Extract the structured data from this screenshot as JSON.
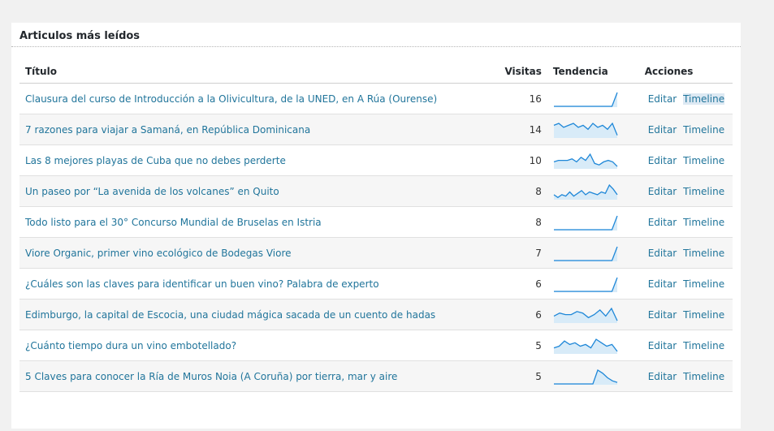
{
  "widget": {
    "title": "Articulos más leídos"
  },
  "columns": {
    "title": "Título",
    "visits": "Visitas",
    "trend": "Tendencia",
    "actions": "Acciones"
  },
  "action_labels": {
    "edit": "Editar",
    "timeline": "Timeline"
  },
  "colors": {
    "sparkline_line": "#1e87d8",
    "sparkline_fill": "#d8ebf8",
    "link": "#21759b"
  },
  "rows": [
    {
      "title": "Clausura del curso de Introducción a la Olivicultura, de la UNED, en A Rúa (Ourense)",
      "visits": "16",
      "trend": [
        0,
        0,
        0,
        0,
        0,
        0,
        0,
        0,
        0,
        0,
        0,
        0,
        10
      ]
    },
    {
      "title": "7 razones para viajar a Samaná, en República Dominicana",
      "visits": "14",
      "trend": [
        6,
        7,
        5,
        6,
        7,
        5,
        6,
        4,
        7,
        5,
        6,
        4,
        7,
        1
      ]
    },
    {
      "title": "Las 8 mejores playas de Cuba que no debes perderte",
      "visits": "10",
      "trend": [
        4,
        5,
        5,
        5,
        6,
        4,
        7,
        5,
        9,
        3,
        2,
        4,
        5,
        4,
        1
      ]
    },
    {
      "title": "Un paseo por “La avenida de los volcanes” en Quito",
      "visits": "8",
      "trend": [
        3,
        1,
        3,
        2,
        5,
        2,
        4,
        6,
        3,
        5,
        4,
        3,
        5,
        4,
        10,
        7,
        3
      ]
    },
    {
      "title": "Todo listo para el 30° Concurso Mundial de Bruselas en Istria",
      "visits": "8",
      "trend": [
        0,
        0,
        0,
        0,
        0,
        0,
        0,
        0,
        0,
        0,
        0,
        0,
        10
      ]
    },
    {
      "title": "Viore Organic, primer vino ecológico de Bodegas Viore",
      "visits": "7",
      "trend": [
        0,
        0,
        0,
        0,
        0,
        0,
        0,
        0,
        0,
        0,
        0,
        0,
        10
      ]
    },
    {
      "title": "¿Cuáles son las claves para identificar un buen vino? Palabra de experto",
      "visits": "6",
      "trend": [
        0,
        0,
        0,
        0,
        0,
        0,
        0,
        0,
        0,
        0,
        0,
        0,
        10
      ]
    },
    {
      "title": "Edimburgo, la capital de Escocia, una ciudad mágica sacada de un cuento de hadas",
      "visits": "6",
      "trend": [
        4,
        6,
        5,
        5,
        7,
        6,
        3,
        5,
        8,
        4,
        9,
        1
      ]
    },
    {
      "title": "¿Cuánto tiempo dura un vino embotellado?",
      "visits": "5",
      "trend": [
        3,
        4,
        7,
        5,
        6,
        4,
        5,
        3,
        8,
        6,
        4,
        5,
        1
      ]
    },
    {
      "title": "5 Claves para conocer la Ría de Muros Noia (A Coruña) por tierra, mar y aire",
      "visits": "5",
      "trend": [
        0,
        0,
        0,
        0,
        0,
        0,
        0,
        0,
        0,
        9,
        7,
        4,
        2,
        1
      ]
    }
  ]
}
